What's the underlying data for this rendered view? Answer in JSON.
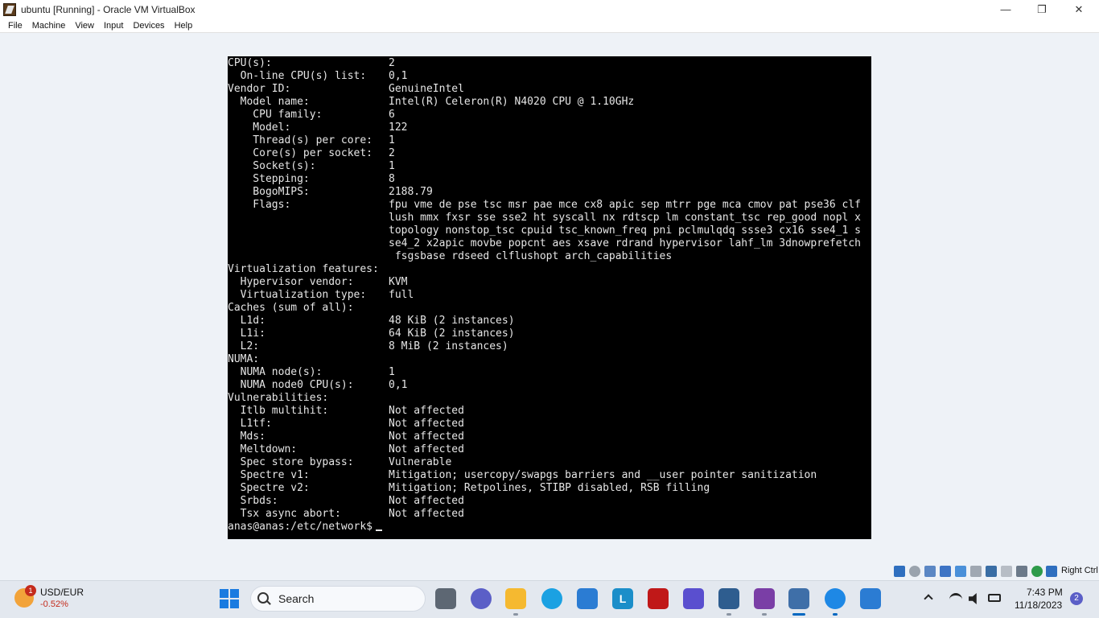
{
  "window": {
    "title": "ubuntu [Running] - Oracle VM VirtualBox",
    "controls": {
      "minimize": "—",
      "restore": "❐",
      "close": "✕"
    }
  },
  "menu": [
    "File",
    "Machine",
    "View",
    "Input",
    "Devices",
    "Help"
  ],
  "terminal": {
    "rows": [
      {
        "label": "CPU(s):",
        "value": "2"
      },
      {
        "label": "  On-line CPU(s) list:",
        "value": "0,1"
      },
      {
        "label": "Vendor ID:",
        "value": "GenuineIntel"
      },
      {
        "label": "  Model name:",
        "value": "Intel(R) Celeron(R) N4020 CPU @ 1.10GHz"
      },
      {
        "label": "    CPU family:",
        "value": "6"
      },
      {
        "label": "    Model:",
        "value": "122"
      },
      {
        "label": "    Thread(s) per core:",
        "value": "1"
      },
      {
        "label": "    Core(s) per socket:",
        "value": "2"
      },
      {
        "label": "    Socket(s):",
        "value": "1"
      },
      {
        "label": "    Stepping:",
        "value": "8"
      },
      {
        "label": "    BogoMIPS:",
        "value": "2188.79"
      },
      {
        "label": "    Flags:",
        "value": "fpu vme de pse tsc msr pae mce cx8 apic sep mtrr pge mca cmov pat pse36 clf"
      },
      {
        "label": "",
        "value": "lush mmx fxsr sse sse2 ht syscall nx rdtscp lm constant_tsc rep_good nopl x"
      },
      {
        "label": "",
        "value": "topology nonstop_tsc cpuid tsc_known_freq pni pclmulqdq ssse3 cx16 sse4_1 s"
      },
      {
        "label": "",
        "value": "se4_2 x2apic movbe popcnt aes xsave rdrand hypervisor lahf_lm 3dnowprefetch"
      },
      {
        "label": "",
        "value": " fsgsbase rdseed clflushopt arch_capabilities"
      },
      {
        "label": "Virtualization features:",
        "value": ""
      },
      {
        "label": "  Hypervisor vendor:",
        "value": "KVM"
      },
      {
        "label": "  Virtualization type:",
        "value": "full"
      },
      {
        "label": "Caches (sum of all):",
        "value": ""
      },
      {
        "label": "  L1d:",
        "value": "48 KiB (2 instances)"
      },
      {
        "label": "  L1i:",
        "value": "64 KiB (2 instances)"
      },
      {
        "label": "  L2:",
        "value": "8 MiB (2 instances)"
      },
      {
        "label": "NUMA:",
        "value": ""
      },
      {
        "label": "  NUMA node(s):",
        "value": "1"
      },
      {
        "label": "  NUMA node0 CPU(s):",
        "value": "0,1"
      },
      {
        "label": "Vulnerabilities:",
        "value": ""
      },
      {
        "label": "  Itlb multihit:",
        "value": "Not affected"
      },
      {
        "label": "  L1tf:",
        "value": "Not affected"
      },
      {
        "label": "  Mds:",
        "value": "Not affected"
      },
      {
        "label": "  Meltdown:",
        "value": "Not affected"
      },
      {
        "label": "  Spec store bypass:",
        "value": "Vulnerable"
      },
      {
        "label": "  Spectre v1:",
        "value": "Mitigation; usercopy/swapgs barriers and __user pointer sanitization"
      },
      {
        "label": "  Spectre v2:",
        "value": "Mitigation; Retpolines, STIBP disabled, RSB filling"
      },
      {
        "label": "  Srbds:",
        "value": "Not affected"
      },
      {
        "label": "  Tsx async abort:",
        "value": "Not affected"
      }
    ],
    "prompt": "anas@anas:/etc/network$"
  },
  "statusbar": {
    "host_key": "Right Ctrl",
    "icons": [
      "hard-disk-icon",
      "optical-drive-icon",
      "audio-icon",
      "network-icon",
      "usb-icon",
      "shared-folders-icon",
      "display-icon",
      "video-capture-icon",
      "cpu-icon",
      "mouse-integration-icon",
      "keyboard-icon"
    ]
  },
  "taskbar": {
    "widget": {
      "title": "USD/EUR",
      "change": "-0.52%",
      "badge": "1"
    },
    "search_label": "Search",
    "apps": [
      "task-view",
      "teams",
      "file-explorer",
      "edge",
      "store",
      "libreoffice",
      "mcafee",
      "app-purple",
      "virtualbox-manager",
      "winrar",
      "virtualbox-vm",
      "app-blue-circle",
      "app-photos"
    ],
    "clock": {
      "time": "7:43 PM",
      "date": "11/18/2023"
    },
    "notifications": "2"
  },
  "colors": {
    "terminal_bg": "#000000",
    "terminal_fg": "#e6e6e6",
    "desktop_bg": "#eef2f7",
    "taskbar_bg": "#e3e8ef",
    "accent": "#0067c0"
  }
}
